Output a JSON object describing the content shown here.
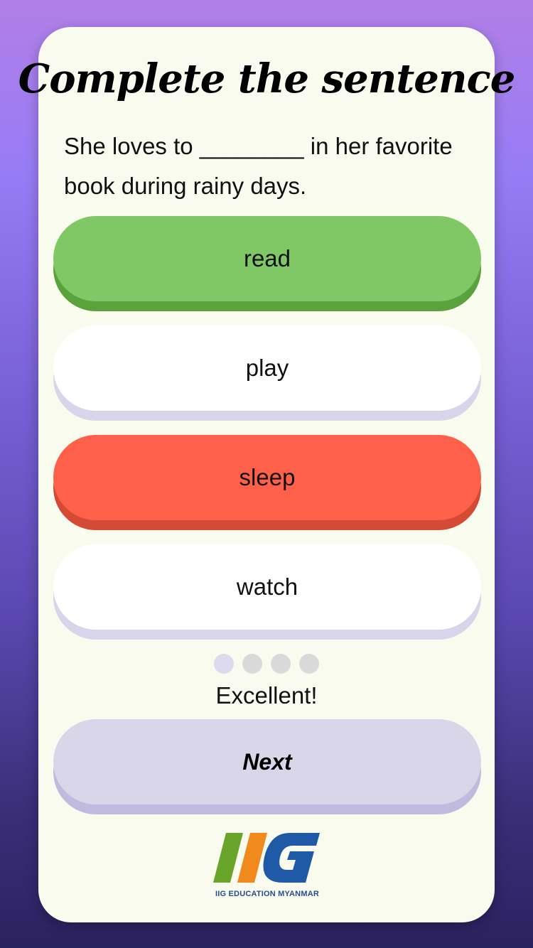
{
  "quiz": {
    "title": "Complete the sentence",
    "sentence": "She loves to ________ in her favorite book during rainy days.",
    "options": [
      {
        "label": "read",
        "state": "correct"
      },
      {
        "label": "play",
        "state": "neutral"
      },
      {
        "label": "sleep",
        "state": "wrong"
      },
      {
        "label": "watch",
        "state": "neutral"
      }
    ],
    "progress": {
      "total": 4,
      "current": 1
    },
    "feedback": "Excellent!",
    "next_label": "Next"
  },
  "logo": {
    "text": "IIG EDUCATION MYANMAR",
    "colors": {
      "green": "#6aa52b",
      "orange": "#f08a1c",
      "blue": "#1f5aa6"
    }
  },
  "colors": {
    "correct": "#80c766",
    "wrong": "#ff6049",
    "neutral": "#ffffff",
    "card": "#fafbef"
  }
}
